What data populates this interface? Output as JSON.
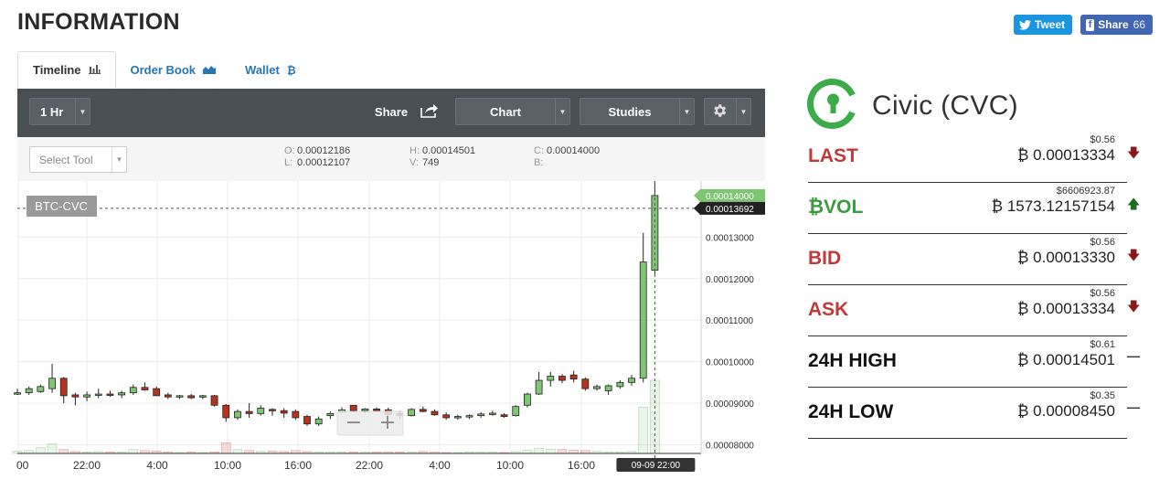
{
  "page": {
    "heading": "INFORMATION",
    "tweet_label": "Tweet",
    "share_label": "Share",
    "share_count": "66"
  },
  "tabs": [
    {
      "label": "Timeline",
      "icon": "bar-chart-icon",
      "active": true
    },
    {
      "label": "Order Book",
      "icon": "area-chart-icon",
      "active": false
    },
    {
      "label": "Wallet",
      "icon": "bitcoin-icon",
      "active": false
    }
  ],
  "toolbar": {
    "interval": "1 Hr",
    "share": "Share",
    "chart": "Chart",
    "studies": "Studies"
  },
  "infobar": {
    "select_tool_placeholder": "Select Tool",
    "open": "0.00012186",
    "low": "0.00012107",
    "high": "0.00014501",
    "volume": "749",
    "close": "0.00014000",
    "b_value": ""
  },
  "chart_data": {
    "type": "candlestick",
    "symbol_label": "BTC-CVC",
    "x_tick_labels": [
      "00",
      "22:00",
      "4:00",
      "10:00",
      "16:00",
      "22:00",
      "4:00",
      "10:00",
      "16:00"
    ],
    "y_tick_labels": [
      "0.00008000",
      "0.00009000",
      "0.00010000",
      "0.00011000",
      "0.00012000",
      "0.00013000"
    ],
    "ylim": [
      7.79e-05,
      0.0001435
    ],
    "last_price_label": "0.00014000",
    "crosshair_price_label": "0.00013692",
    "crosshair_time_label": "09-09 22:00",
    "grid": true,
    "candles": [
      [
        9.25e-05,
        9.35e-05,
        9.2e-05,
        9.25e-05
      ],
      [
        9.25e-05,
        9.4e-05,
        9.2e-05,
        9.35e-05
      ],
      [
        9.28e-05,
        9.45e-05,
        9.25e-05,
        9.4e-05
      ],
      [
        9.35e-05,
        9.95e-05,
        9.25e-05,
        9.6e-05
      ],
      [
        9.6e-05,
        9.63e-05,
        9e-05,
        9.18e-05
      ],
      [
        9.2e-05,
        9.25e-05,
        8.95e-05,
        9.15e-05
      ],
      [
        9.15e-05,
        9.28e-05,
        9.05e-05,
        9.2e-05
      ],
      [
        9.2e-05,
        9.35e-05,
        9.12e-05,
        9.22e-05
      ],
      [
        9.22e-05,
        9.3e-05,
        9.15e-05,
        9.2e-05
      ],
      [
        9.2e-05,
        9.3e-05,
        9.12e-05,
        9.25e-05
      ],
      [
        9.25e-05,
        9.45e-05,
        9.2e-05,
        9.38e-05
      ],
      [
        9.38e-05,
        9.5e-05,
        9.3e-05,
        9.32e-05
      ],
      [
        9.35e-05,
        9.4e-05,
        9.2e-05,
        9.18e-05
      ],
      [
        9.2e-05,
        9.25e-05,
        9.1e-05,
        9.15e-05
      ],
      [
        9.15e-05,
        9.2e-05,
        9.1e-05,
        9.18e-05
      ],
      [
        9.18e-05,
        9.22e-05,
        9.1e-05,
        9.13e-05
      ],
      [
        9.15e-05,
        9.2e-05,
        9.1e-05,
        9.18e-05
      ],
      [
        9.18e-05,
        9.2e-05,
        8.92e-05,
        8.95e-05
      ],
      [
        8.95e-05,
        8.98e-05,
        8.55e-05,
        8.65e-05
      ],
      [
        8.65e-05,
        8.85e-05,
        8.6e-05,
        8.8e-05
      ],
      [
        8.8e-05,
        9e-05,
        8.65e-05,
        8.75e-05
      ],
      [
        8.75e-05,
        8.95e-05,
        8.7e-05,
        8.88e-05
      ],
      [
        8.85e-05,
        8.88e-05,
        8.7e-05,
        8.82e-05
      ],
      [
        8.82e-05,
        8.88e-05,
        8.65e-05,
        8.76e-05
      ],
      [
        8.8e-05,
        8.85e-05,
        8.6e-05,
        8.65e-05
      ],
      [
        8.68e-05,
        8.72e-05,
        8.45e-05,
        8.5e-05
      ],
      [
        8.5e-05,
        8.68e-05,
        8.45e-05,
        8.62e-05
      ],
      [
        8.7e-05,
        8.8e-05,
        8.62e-05,
        8.75e-05
      ],
      [
        8.78e-05,
        8.9e-05,
        8.75e-05,
        8.84e-05
      ],
      [
        8.95e-05,
        8.95e-05,
        8.78e-05,
        8.82e-05
      ],
      [
        8.82e-05,
        8.88e-05,
        8.75e-05,
        8.86e-05
      ],
      [
        8.86e-05,
        8.9e-05,
        8.78e-05,
        8.82e-05
      ],
      [
        8.84e-05,
        8.89e-05,
        8.7e-05,
        8.73e-05
      ],
      [
        8.75e-05,
        8.82e-05,
        8.6e-05,
        8.7e-05
      ],
      [
        8.7e-05,
        8.88e-05,
        8.68e-05,
        8.85e-05
      ],
      [
        8.85e-05,
        8.92e-05,
        8.78e-05,
        8.8e-05
      ],
      [
        8.8e-05,
        8.85e-05,
        8.7e-05,
        8.72e-05
      ],
      [
        8.72e-05,
        8.78e-05,
        8.6e-05,
        8.65e-05
      ],
      [
        8.65e-05,
        8.72e-05,
        8.6e-05,
        8.68e-05
      ],
      [
        8.68e-05,
        8.73e-05,
        8.62e-05,
        8.7e-05
      ],
      [
        8.7e-05,
        8.78e-05,
        8.65e-05,
        8.74e-05
      ],
      [
        8.74e-05,
        8.82e-05,
        8.7e-05,
        8.76e-05
      ],
      [
        8.72e-05,
        8.76e-05,
        8.65e-05,
        8.68e-05
      ],
      [
        8.7e-05,
        8.95e-05,
        8.68e-05,
        8.92e-05
      ],
      [
        8.95e-05,
        9.25e-05,
        8.9e-05,
        9.22e-05
      ],
      [
        9.22e-05,
        9.75e-05,
        9.2e-05,
        9.55e-05
      ],
      [
        9.55e-05,
        9.75e-05,
        9.4e-05,
        9.65e-05
      ],
      [
        9.65e-05,
        9.7e-05,
        9.48e-05,
        9.55e-05
      ],
      [
        9.68e-05,
        9.78e-05,
        9.5e-05,
        9.58e-05
      ],
      [
        9.58e-05,
        9.62e-05,
        9.3e-05,
        9.35e-05
      ],
      [
        9.35e-05,
        9.45e-05,
        9.3e-05,
        9.4e-05
      ],
      [
        9.3e-05,
        9.45e-05,
        9.2e-05,
        9.42e-05
      ],
      [
        9.4e-05,
        9.55e-05,
        9.35e-05,
        9.5e-05
      ],
      [
        9.5e-05,
        9.68e-05,
        9.42e-05,
        9.6e-05
      ],
      [
        9.6e-05,
        0.000131,
        9.5e-05,
        0.000124
      ],
      [
        0.000122,
        0.0001451,
        0.000121,
        0.00014
      ]
    ],
    "volumes": [
      0.5,
      0.6,
      1.2,
      2.0,
      0.8,
      0.4,
      0.3,
      0.4,
      0.3,
      0.3,
      0.8,
      0.6,
      0.5,
      0.3,
      0.2,
      0.3,
      0.2,
      0.3,
      2.2,
      0.8,
      0.6,
      0.4,
      0.5,
      0.4,
      0.6,
      0.4,
      0.3,
      0.3,
      0.3,
      0.3,
      0.3,
      0.3,
      0.3,
      0.3,
      0.3,
      0.4,
      0.3,
      0.2,
      0.2,
      0.3,
      0.3,
      0.3,
      0.2,
      0.4,
      0.7,
      1.1,
      0.9,
      0.8,
      0.7,
      0.6,
      0.4,
      0.3,
      0.3,
      0.4,
      9.5,
      15.0
    ]
  },
  "coin": {
    "name": "Civic (CVC)",
    "logo_color": "#3cab4a"
  },
  "stats": [
    {
      "label": "LAST",
      "usd": "$0.56",
      "value": "0.00013334",
      "color": "red",
      "arrow": "down"
    },
    {
      "label": "VOL",
      "usd": "$6606923.87",
      "value": "1573.12157154",
      "color": "green",
      "arrow": "up"
    },
    {
      "label": "BID",
      "usd": "$0.56",
      "value": "0.00013330",
      "color": "red",
      "arrow": "down"
    },
    {
      "label": "ASK",
      "usd": "$0.56",
      "value": "0.00013334",
      "color": "red",
      "arrow": "down"
    },
    {
      "label": "24H HIGH",
      "usd": "$0.61",
      "value": "0.00014501",
      "color": "dark",
      "arrow": "flat"
    },
    {
      "label": "24H LOW",
      "usd": "$0.35",
      "value": "0.00008450",
      "color": "dark",
      "arrow": "flat"
    }
  ],
  "currency_symbol": "₿"
}
